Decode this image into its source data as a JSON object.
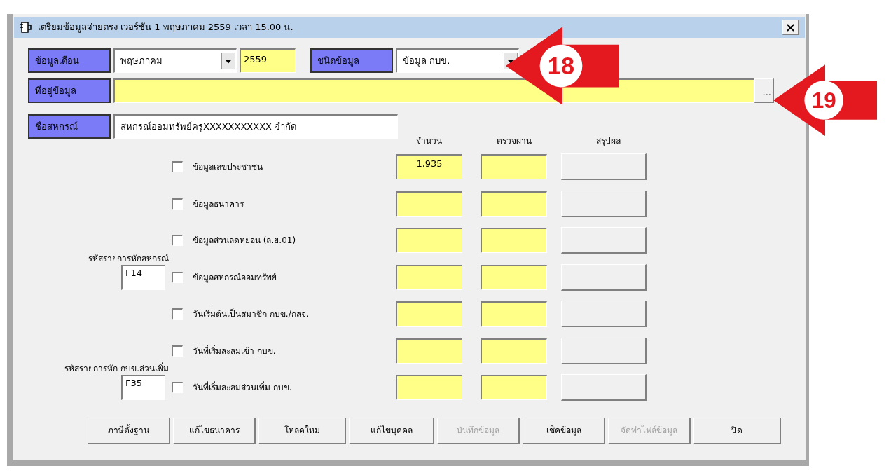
{
  "window": {
    "title": "เตรียมข้อมูลจ่ายตรง  เวอร์ชัน 1 พฤษภาคม 2559 เวลา 15.00 น.",
    "close": "×"
  },
  "header": {
    "month_label": "ข้อมูลเดือน",
    "month": "พฤษภาคม",
    "year": "2559",
    "type_label": "ชนิดข้อมูล",
    "type": "ข้อมูล กบข.",
    "path_label": "ที่อยู่ข้อมูล",
    "browse": "...",
    "coop_label": "ชื่อสหกรณ์",
    "coop_name": "สหกรณ์ออมทรัพย์ครูXXXXXXXXXXX  จำกัด"
  },
  "columns": [
    "จำนวน",
    "ตรวจผ่าน",
    "สรุปผล"
  ],
  "items": [
    {
      "label": "ข้อมูลเลขประชาชน",
      "checked": false,
      "count": "1,935"
    },
    {
      "label": "ข้อมูลธนาคาร",
      "checked": false
    },
    {
      "label": "ข้อมูลส่วนลดหย่อน (ล.ย.01)",
      "checked": false
    },
    {
      "label": "ข้อมูลสหกรณ์ออมทรัพย์",
      "checked": false,
      "code": {
        "label": "รหัสรายการหักสหกรณ์",
        "value": "F14"
      }
    },
    {
      "label": "วันเริ่มต้นเป็นสมาชิก กบข./กสจ.",
      "checked": false
    },
    {
      "label": "วันที่เริ่มสะสมเข้า กบข.",
      "checked": false
    },
    {
      "label": "วันที่เริ่มสะสมส่วนเพิ่ม กบข.",
      "checked": false,
      "code": {
        "label": "รหัสรายการหัก กบข.ส่วนเพิ่ม",
        "value": "F35"
      }
    }
  ],
  "buttons": [
    {
      "label": "ภาษีตั้งฐาน",
      "disabled": false
    },
    {
      "label": "แก้ไขธนาคาร",
      "disabled": false
    },
    {
      "label": "โหลดใหม่",
      "disabled": false
    },
    {
      "label": "แก้ไขบุคคล",
      "disabled": false
    },
    {
      "label": "บันทึกข้อมูล",
      "disabled": true
    },
    {
      "label": "เช็คข้อมูล",
      "disabled": false
    },
    {
      "label": "จัดทำไฟล์ข้อมูล",
      "disabled": true
    },
    {
      "label": "ปิด",
      "disabled": false
    }
  ],
  "callouts": [
    {
      "number": "18"
    },
    {
      "number": "19"
    }
  ]
}
